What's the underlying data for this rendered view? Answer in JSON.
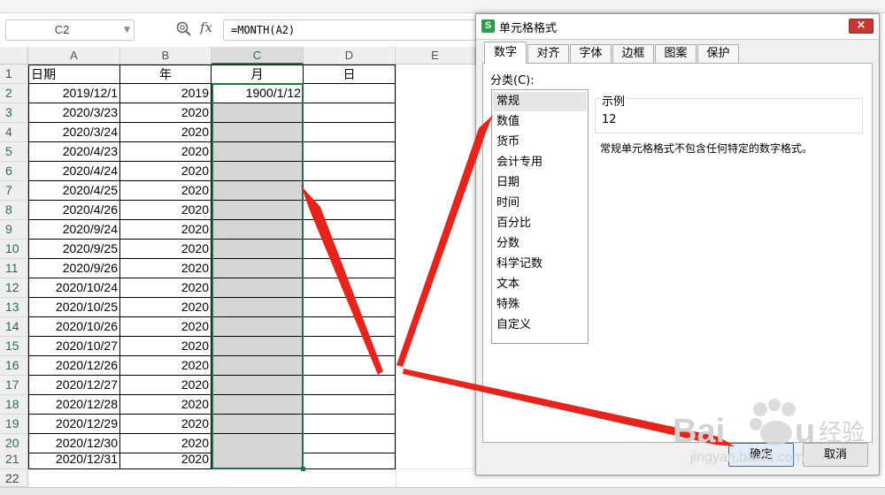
{
  "name_box": {
    "value": "C2"
  },
  "formula_bar": {
    "fx_symbol": "fx",
    "formula": "=MONTH(A2)"
  },
  "columns": [
    "A",
    "B",
    "C",
    "D",
    "E"
  ],
  "row_numbers": [
    "1",
    "2",
    "3",
    "4",
    "5",
    "6",
    "7",
    "8",
    "9",
    "10",
    "11",
    "12",
    "13",
    "14",
    "15",
    "16",
    "17",
    "18",
    "19",
    "20",
    "21",
    "22"
  ],
  "headers": {
    "A": "日期",
    "B": "年",
    "C": "月",
    "D": "日"
  },
  "rows": [
    {
      "A": "2019/12/1",
      "B": "2019",
      "C": "1900/1/12"
    },
    {
      "A": "2020/3/23",
      "B": "2020",
      "C": ""
    },
    {
      "A": "2020/3/24",
      "B": "2020",
      "C": ""
    },
    {
      "A": "2020/4/23",
      "B": "2020",
      "C": ""
    },
    {
      "A": "2020/4/24",
      "B": "2020",
      "C": ""
    },
    {
      "A": "2020/4/25",
      "B": "2020",
      "C": ""
    },
    {
      "A": "2020/4/26",
      "B": "2020",
      "C": ""
    },
    {
      "A": "2020/9/24",
      "B": "2020",
      "C": ""
    },
    {
      "A": "2020/9/25",
      "B": "2020",
      "C": ""
    },
    {
      "A": "2020/9/26",
      "B": "2020",
      "C": ""
    },
    {
      "A": "2020/10/24",
      "B": "2020",
      "C": ""
    },
    {
      "A": "2020/10/25",
      "B": "2020",
      "C": ""
    },
    {
      "A": "2020/10/26",
      "B": "2020",
      "C": ""
    },
    {
      "A": "2020/10/27",
      "B": "2020",
      "C": ""
    },
    {
      "A": "2020/12/26",
      "B": "2020",
      "C": ""
    },
    {
      "A": "2020/12/27",
      "B": "2020",
      "C": ""
    },
    {
      "A": "2020/12/28",
      "B": "2020",
      "C": ""
    },
    {
      "A": "2020/12/29",
      "B": "2020",
      "C": ""
    },
    {
      "A": "2020/12/30",
      "B": "2020",
      "C": ""
    },
    {
      "A": "2020/12/31",
      "B": "2020",
      "C": ""
    }
  ],
  "dialog": {
    "icon_letter": "S",
    "title": "单元格格式",
    "close": "×",
    "tabs": [
      "数字",
      "对齐",
      "字体",
      "边框",
      "图案",
      "保护"
    ],
    "active_tab": "数字",
    "category_label": "分类(C):",
    "categories": [
      "常规",
      "数值",
      "货币",
      "会计专用",
      "日期",
      "时间",
      "百分比",
      "分数",
      "科学记数",
      "文本",
      "特殊",
      "自定义"
    ],
    "selected_category": "常规",
    "sample_label": "示例",
    "sample_value": "12",
    "description": "常规单元格格式不包含任何特定的数字格式。",
    "ok": "确定",
    "cancel": "取消"
  },
  "watermark": {
    "brand": "Baidu",
    "brand_cn": "经验",
    "url": "jingyan.baidu.com"
  },
  "colors": {
    "selection_green": "#217346",
    "arrow_red": "#e8231b",
    "dialog_close": "#c7372f",
    "fill_gray": "#d6d6d6"
  }
}
